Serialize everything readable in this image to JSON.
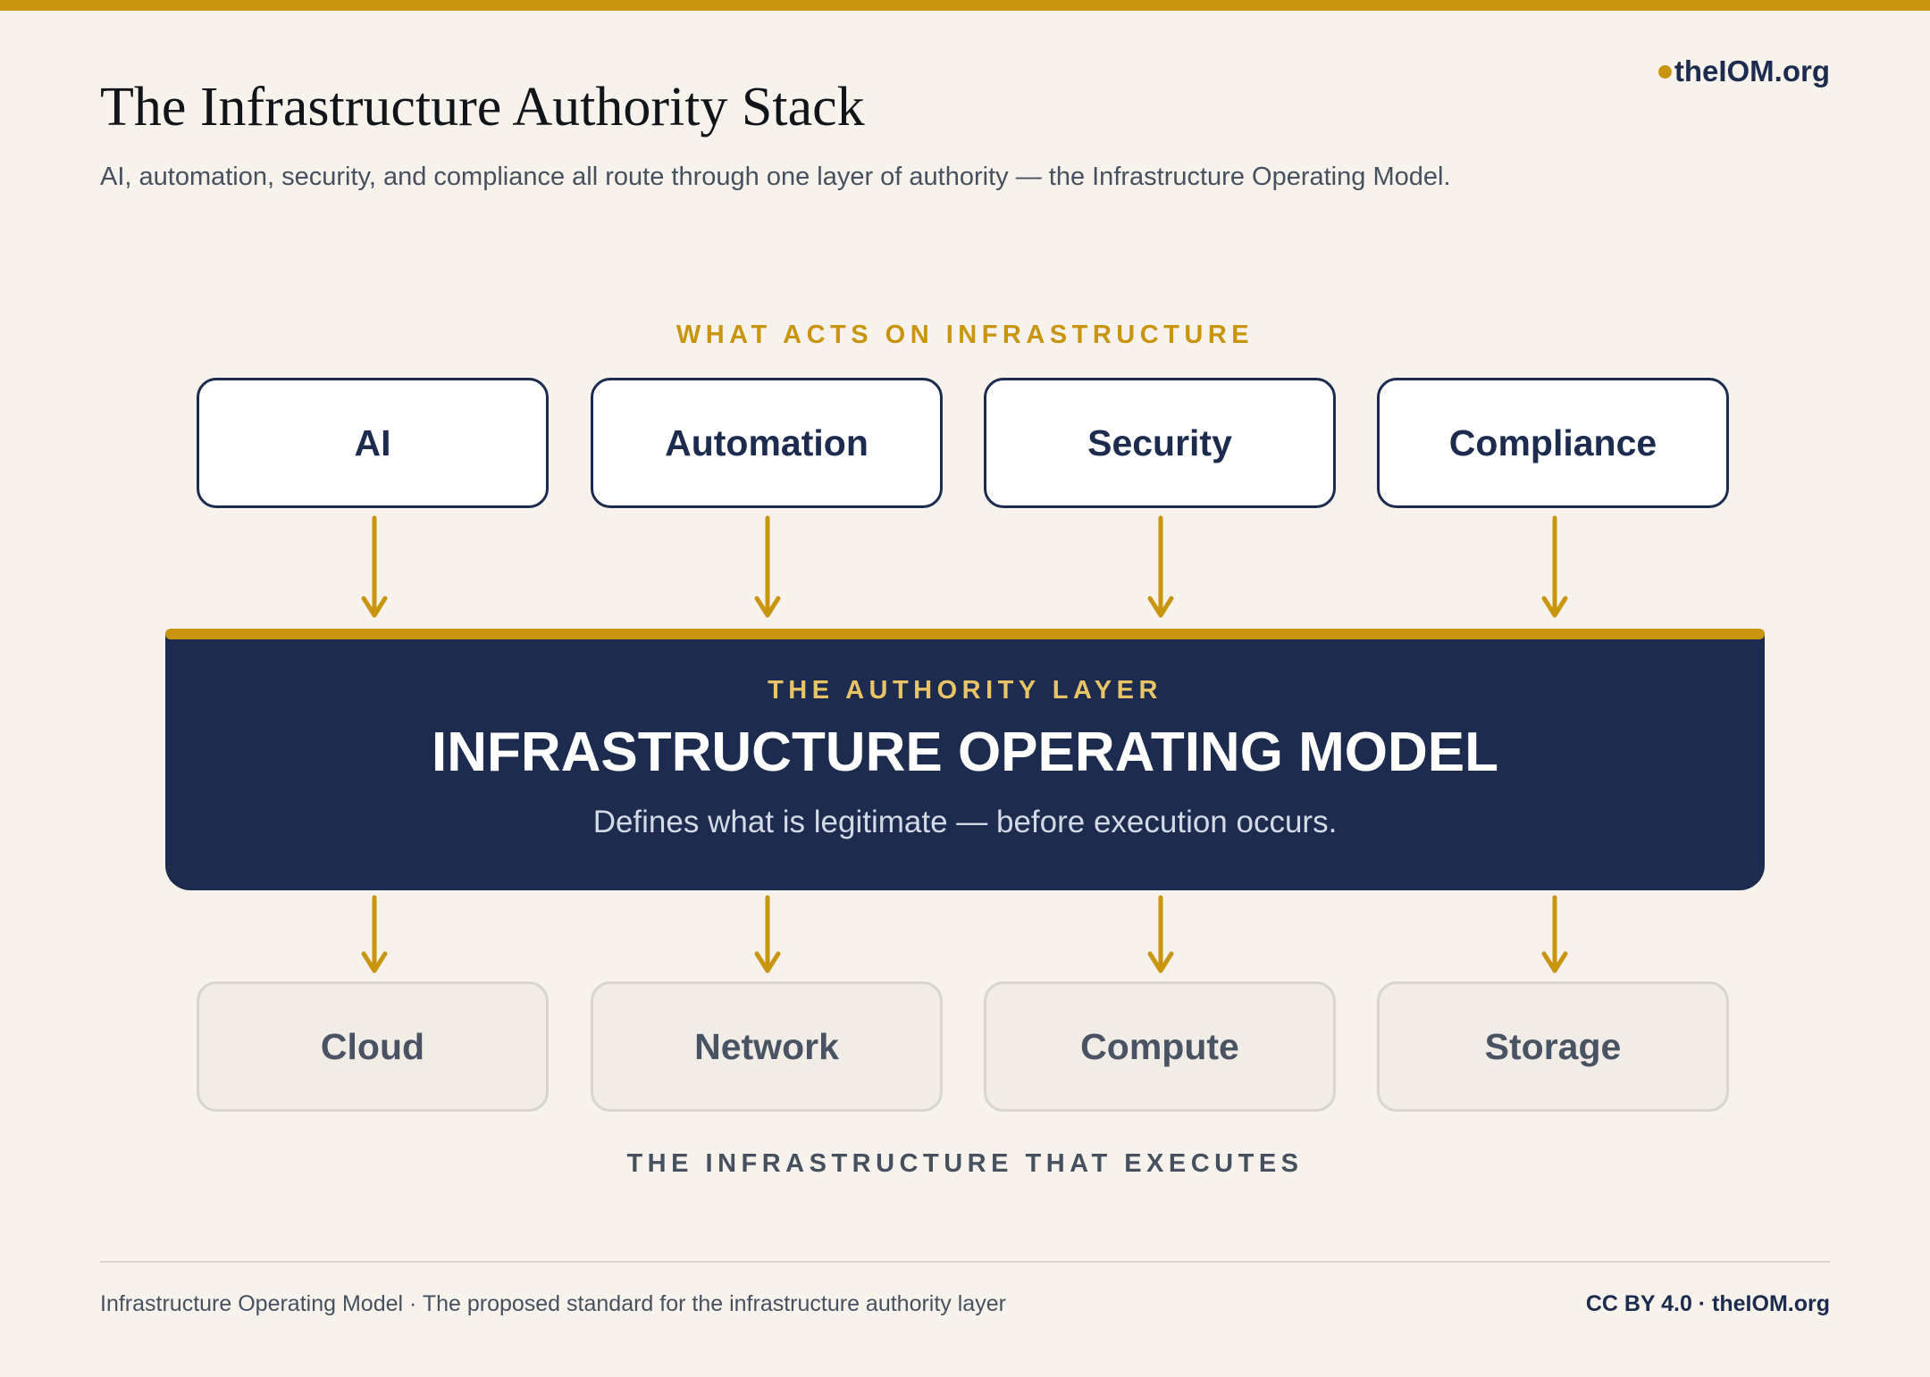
{
  "header": {
    "title": "The Infrastructure Authority Stack",
    "subtitle": "AI, automation, security, and compliance all route through one layer of authority — the Infrastructure Operating Model.",
    "brand": "theIOM.org"
  },
  "diagram": {
    "top_label": "WHAT ACTS ON INFRASTRUCTURE",
    "actors": [
      "AI",
      "Automation",
      "Security",
      "Compliance"
    ],
    "authority": {
      "eyebrow": "THE AUTHORITY LAYER",
      "title": "INFRASTRUCTURE OPERATING MODEL",
      "description": "Defines what is legitimate — before execution occurs."
    },
    "infrastructure": [
      "Cloud",
      "Network",
      "Compute",
      "Storage"
    ],
    "bottom_label": "THE INFRASTRUCTURE THAT EXECUTES"
  },
  "footer": {
    "left": "Infrastructure Operating Model · The proposed standard for the infrastructure authority layer",
    "right": "CC BY 4.0 · theIOM.org"
  },
  "colors": {
    "accent": "#c9950f",
    "navy": "#1c2b4e",
    "background": "#f7f3ec"
  }
}
